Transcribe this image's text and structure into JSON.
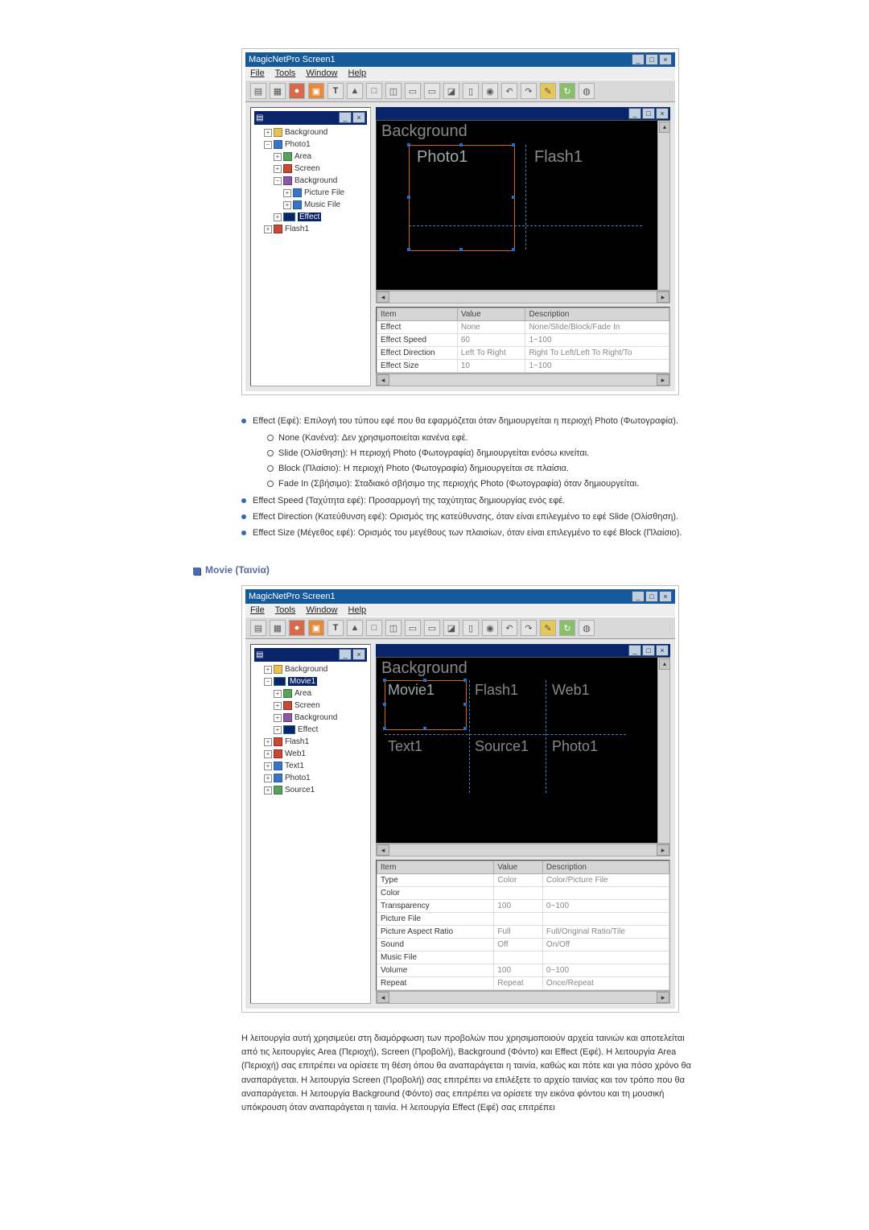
{
  "app": {
    "title": "MagicNetPro Screen1"
  },
  "menu": [
    "File",
    "Tools",
    "Window",
    "Help"
  ],
  "tree_bar": "",
  "shot1": {
    "tree_items": [
      {
        "t": "Background",
        "ico": "fold"
      },
      {
        "t": "Photo1",
        "ico": "blue",
        "children": [
          {
            "t": "Area",
            "ico": "grn"
          },
          {
            "t": "Screen",
            "ico": "red"
          },
          {
            "t": "Background",
            "ico": "pur",
            "children": [
              {
                "t": "Picture File",
                "ico": "blue"
              },
              {
                "t": "Music File",
                "ico": "blue"
              }
            ]
          },
          {
            "t": "Effect",
            "sel": true,
            "ico": "sel"
          }
        ]
      },
      {
        "t": "Flash1",
        "ico": "red"
      }
    ],
    "canvas": {
      "bg": "Background",
      "a": "Photo1",
      "b": "Flash1"
    },
    "grid": {
      "headers": [
        "Item",
        "Value",
        "Description"
      ],
      "rows": [
        [
          "Effect",
          "None",
          "None/Slide/Block/Fade In"
        ],
        [
          "Effect Speed",
          "60",
          "1~100"
        ],
        [
          "Effect Direction",
          "Left To Right",
          "Right To Left/Left To Right/To"
        ],
        [
          "Effect Size",
          "10",
          "1~100"
        ]
      ]
    }
  },
  "text1": {
    "items": [
      {
        "label": "Effect (Εφέ): Επιλογή του τύπου εφέ που θα εφαρμόζεται όταν δημιουργείται η περιοχή Photo (Φωτογραφία).",
        "sub": [
          "None (Κανένα): Δεν χρησιμοποιείται κανένα εφέ.",
          "Slide (Ολίσθηση): Η περιοχή Photo (Φωτογραφία) δημιουργείται ενόσω κινείται.",
          "Block (Πλαίσιο): Η περιοχή Photo (Φωτογραφία) δημιουργείται σε πλαίσια.",
          "Fade In (Σβήσιμο): Σταδιακό σβήσιμο της περιοχής Photo (Φωτογραφία) όταν δημιουργείται."
        ]
      },
      {
        "label": "Effect Speed (Ταχύτητα εφέ): Προσαρμογή της ταχύτητας δημιουργίας ενός εφέ."
      },
      {
        "label": "Effect Direction (Κατεύθυνση εφέ): Ορισμός της κατεύθυνσης, όταν είναι επιλεγμένο το εφέ Slide (Ολίσθηση)."
      },
      {
        "label": "Effect Size (Μέγεθος εφέ): Ορισμός του μεγέθους των πλαισίων, όταν είναι επιλεγμένο το εφέ Block (Πλαίσιο)."
      }
    ]
  },
  "section2": "Movie (Ταινία)",
  "shot2": {
    "tree_items": [
      {
        "t": "Background",
        "ico": "fold"
      },
      {
        "t": "Movie1",
        "sel": true,
        "ico": "sel",
        "children": [
          {
            "t": "Area",
            "ico": "grn"
          },
          {
            "t": "Screen",
            "ico": "red"
          },
          {
            "t": "Background",
            "ico": "pur"
          },
          {
            "t": "Effect",
            "ico": "sel"
          }
        ]
      },
      {
        "t": "Flash1",
        "ico": "red"
      },
      {
        "t": "Web1",
        "ico": "red"
      },
      {
        "t": "Text1",
        "ico": "blue"
      },
      {
        "t": "Photo1",
        "ico": "blue"
      },
      {
        "t": "Source1",
        "ico": "grn"
      }
    ],
    "canvas": {
      "bg": "Background",
      "cells": [
        "Movie1",
        "Flash1",
        "Web1",
        "Text1",
        "Source1",
        "Photo1"
      ]
    },
    "grid": {
      "headers": [
        "Item",
        "Value",
        "Description"
      ],
      "rows": [
        [
          "Type",
          "Color",
          "Color/Picture File"
        ],
        [
          "Color",
          "",
          ""
        ],
        [
          "Transparency",
          "100",
          "0~100"
        ],
        [
          "Picture File",
          "",
          ""
        ],
        [
          "Picture Aspect Ratio",
          "Full",
          "Full/Original Ratio/Tile"
        ],
        [
          "Sound",
          "Off",
          "On/Off"
        ],
        [
          "Music File",
          "",
          ""
        ],
        [
          "Volume",
          "100",
          "0~100"
        ],
        [
          "Repeat",
          "Repeat",
          "Once/Repeat"
        ]
      ]
    }
  },
  "para2": "Η λειτουργία αυτή χρησιμεύει στη διαμόρφωση των προβολών που χρησιμοποιούν αρχεία ταινιών και αποτελείται από τις λειτουργίες Area (Περιοχή), Screen (Προβολή), Background (Φόντο) και Effect (Εφέ). Η λειτουργία Area (Περιοχή) σας επιτρέπει να ορίσετε τη θέση όπου θα αναπαράγεται η ταινία, καθώς και πότε και για πόσο χρόνο θα αναπαράγεται. Η λειτουργία Screen (Προβολή) σας επιτρέπει να επιλέξετε το αρχείο ταινίας και τον τρόπο που θα αναπαράγεται. Η λειτουργία Background (Φόντο) σας επιτρέπει να ορίσετε την εικόνα φόντου και τη μουσική υπόκρουση όταν αναπαράγεται η ταινία. Η λειτουργία Effect (Εφέ) σας επιτρέπει"
}
